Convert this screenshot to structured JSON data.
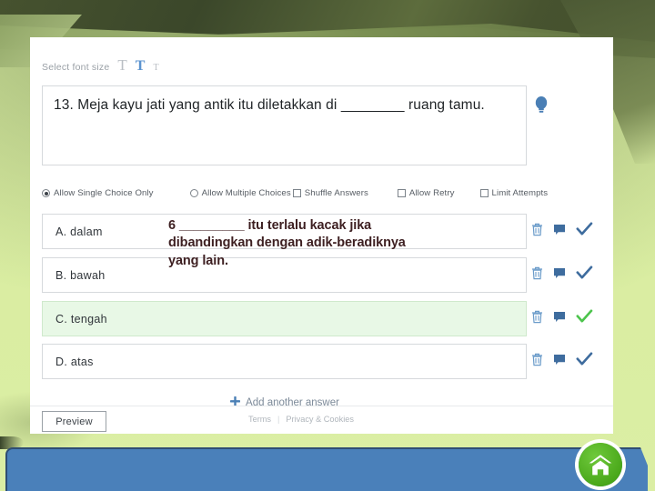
{
  "toolbar": {
    "font_size_label": "Select font size",
    "size_large": "T",
    "size_medium": "T",
    "size_small": "T"
  },
  "question": {
    "text": "13. Meja kayu jati yang antik itu diletakkan di ________ ruang tamu.",
    "hint_icon": "lightbulb-icon"
  },
  "choice_options": [
    {
      "label": "Allow Single Choice Only",
      "control": "radio",
      "checked": true
    },
    {
      "label": "Allow Multiple Choices",
      "control": "radio",
      "checked": false
    },
    {
      "label": "Shuffle Answers",
      "control": "checkbox",
      "checked": false
    },
    {
      "label": "Allow Retry",
      "control": "checkbox",
      "checked": false
    },
    {
      "label": "Limit Attempts",
      "control": "checkbox",
      "checked": false
    }
  ],
  "answers": [
    {
      "text": "A.  dalam",
      "correct": false,
      "check_color": "#3e6c9e"
    },
    {
      "text": "B.  bawah",
      "correct": false,
      "check_color": "#3e6c9e"
    },
    {
      "text": "C.  tengah",
      "correct": true,
      "check_color": "#4cc44c"
    },
    {
      "text": "D.  atas",
      "correct": false,
      "check_color": "#3e6c9e"
    }
  ],
  "row_icons": {
    "delete": "trash-icon",
    "comment": "comment-icon",
    "mark_correct": "check-icon"
  },
  "overlay_note": {
    "line1": "6 _________ itu terlalu kacak jika",
    "line2": "dibandingkan dengan adik-beradiknya",
    "line3": "yang lain."
  },
  "add_answer": {
    "label": "Add another answer",
    "icon": "plus-icon"
  },
  "footer": {
    "preview_label": "Preview",
    "terms_label": "Terms",
    "divider": "|",
    "privacy_label": "Privacy & Cookies"
  },
  "bottom_bar": {
    "home_icon": "home-icon"
  },
  "colors": {
    "accent_blue": "#3e6c9e",
    "trash_blue": "#6a9bc9",
    "correct_green": "#4cc44c",
    "correct_row_bg": "#e8f8e6",
    "bar_blue": "#4a80ba",
    "home_green": "#4aa81a",
    "overlay_text": "#3d1f21"
  }
}
